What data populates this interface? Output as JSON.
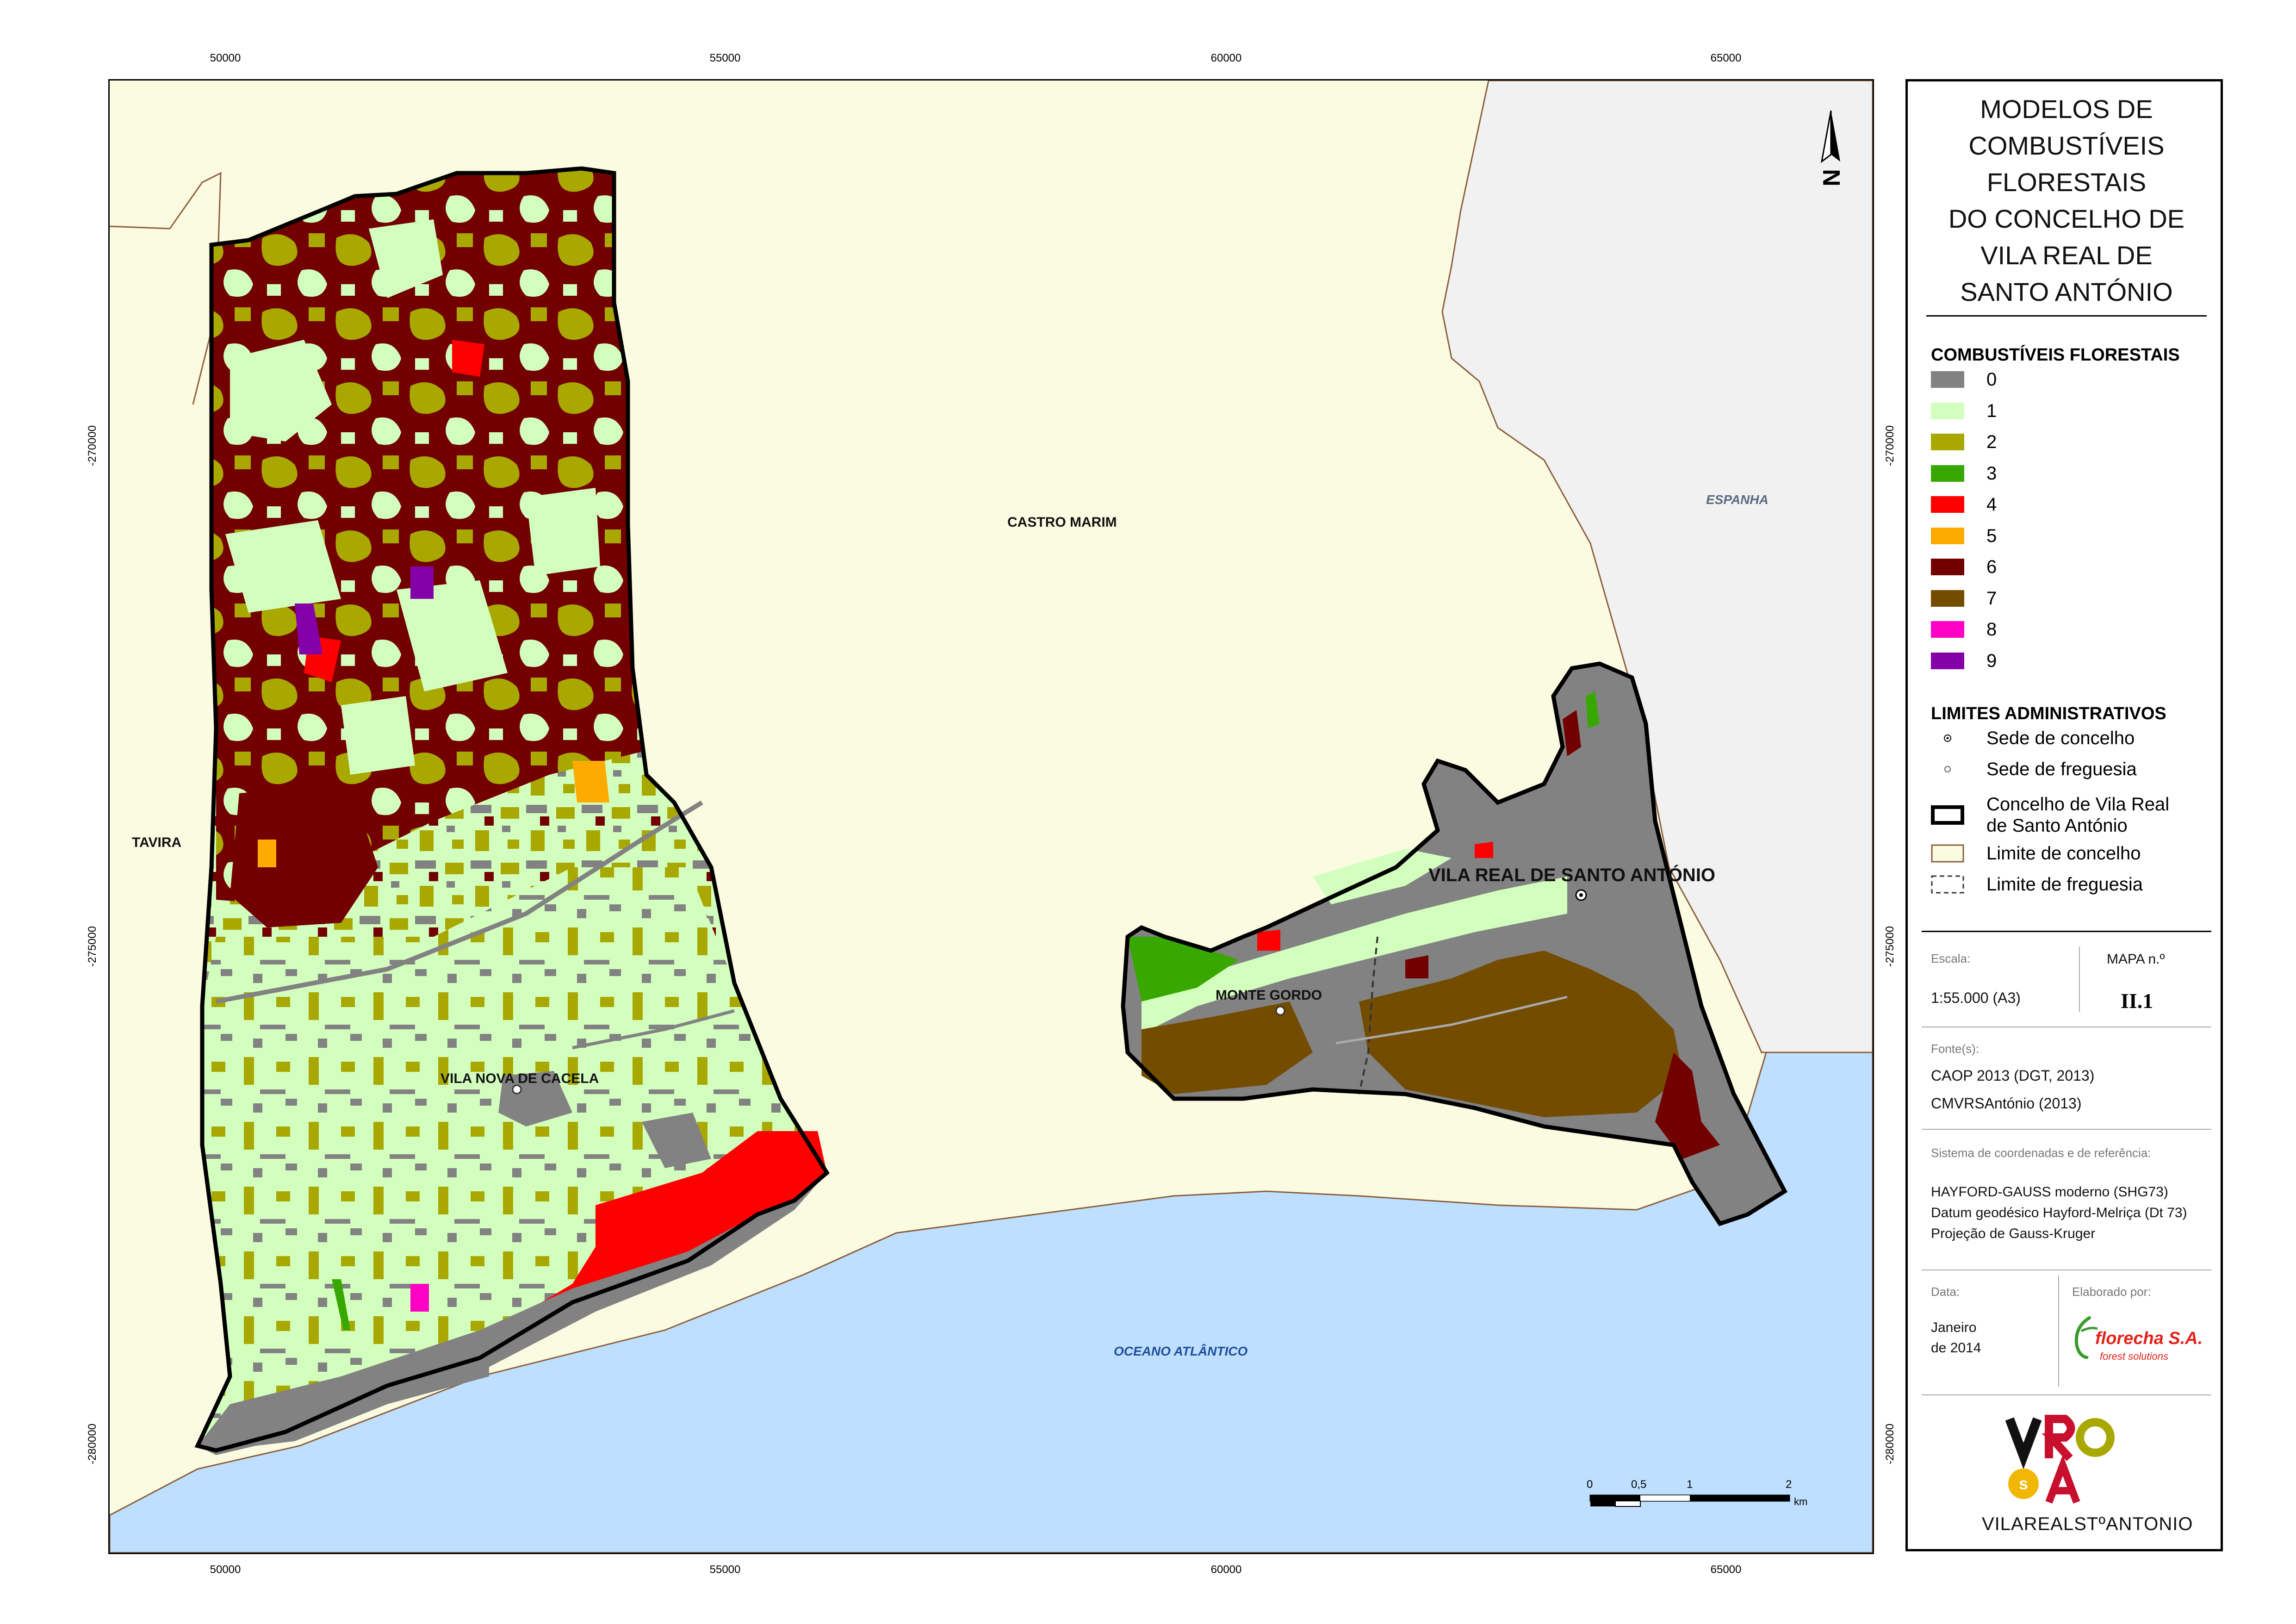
{
  "map": {
    "ticks": {
      "x": [
        "50000",
        "55000",
        "60000",
        "65000"
      ],
      "y": [
        "-270000",
        "-275000",
        "-280000"
      ]
    },
    "places": {
      "castro_marim": "CASTRO MARIM",
      "espanha": "ESPANHA",
      "tavira": "TAVIRA",
      "vila_real": "VILA REAL DE SANTO ANTÓNIO",
      "monte_gordo": "MONTE GORDO",
      "vila_nova": "VILA NOVA DE CACELA",
      "oceano": "OCEANO ATLÂNTICO"
    },
    "scale_bar": {
      "labels": [
        "0",
        "0,5",
        "1",
        "2"
      ],
      "unit": "km"
    },
    "north_arrow": "N",
    "colors": {
      "land": "#fbfbe1",
      "spain": "#f1f1f1",
      "sea": "#bedfff",
      "border": "#8b5e3c"
    }
  },
  "legend": {
    "title": "MODELOS DE COMBUSTÍVEIS FLORESTAIS DO CONCELHO DE VILA REAL DE SANTO ANTÓNIO",
    "title_lines": [
      "MODELOS DE",
      "COMBUSTÍVEIS",
      "FLORESTAIS",
      "DO CONCELHO DE",
      "VILA REAL DE",
      "SANTO ANTÓNIO"
    ],
    "fuel_heading": "COMBUSTÍVEIS FLORESTAIS",
    "fuel_classes": [
      {
        "label": "0",
        "color": "#828282"
      },
      {
        "label": "1",
        "color": "#d3ffbe"
      },
      {
        "label": "2",
        "color": "#a8a800"
      },
      {
        "label": "3",
        "color": "#38a800"
      },
      {
        "label": "4",
        "color": "#ff0000"
      },
      {
        "label": "5",
        "color": "#ffaa00"
      },
      {
        "label": "6",
        "color": "#730000"
      },
      {
        "label": "7",
        "color": "#734c00"
      },
      {
        "label": "8",
        "color": "#ff00c5"
      },
      {
        "label": "9",
        "color": "#8400a8"
      }
    ],
    "admin_heading": "LIMITES ADMINISTRATIVOS",
    "admin_items": [
      {
        "label": "Sede de concelho"
      },
      {
        "label": "Sede de freguesia"
      },
      {
        "label": "Concelho de Vila Real de Santo António",
        "lines": [
          "Concelho de Vila Real",
          "de Santo António"
        ]
      },
      {
        "label": "Limite de concelho"
      },
      {
        "label": "Limite de freguesia"
      }
    ],
    "scale_label": "Escala:",
    "scale_value": "1:55.000",
    "paper": "(A3)",
    "map_label": "MAPA  n.º",
    "map_number": "II.1",
    "sources_label": "Fonte(s):",
    "sources": [
      "CAOP 2013 (DGT, 2013)",
      "CMVRSAntónio (2013)"
    ],
    "crs_label": "Sistema de coordenadas e de referência:",
    "crs": [
      "HAYFORD-GAUSS moderno (SHG73)",
      "Datum geodésico Hayford-Melriça (Dt 73)",
      "Projeção de Gauss-Kruger"
    ],
    "date_label": "Data:",
    "date_lines": [
      "Janeiro",
      "de 2014"
    ],
    "author_label": "Elaborado por:",
    "author_name": "florecha S.A.",
    "author_tagline": "forest solutions",
    "logo_text": "VILAREALSTºANTONIO"
  }
}
